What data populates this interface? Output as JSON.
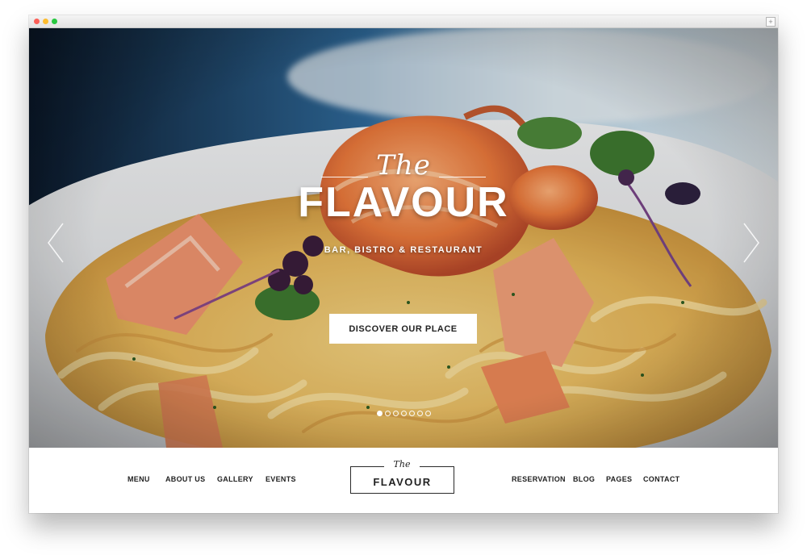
{
  "hero": {
    "logo_the": "The",
    "logo_main": "FLAVOUR",
    "tagline": "BAR, BISTRO & RESTAURANT",
    "cta_label": "DISCOVER OUR PLACE",
    "slide_count": 7,
    "active_slide": 1
  },
  "nav": {
    "left": [
      "MENU",
      "ABOUT US",
      "GALLERY",
      "EVENTS"
    ],
    "right": [
      "RESERVATION",
      "BLOG",
      "PAGES",
      "CONTACT"
    ],
    "logo_the": "The",
    "logo_main": "FLAVOUR"
  },
  "icons": {
    "prev": "chevron-left-icon",
    "next": "chevron-right-icon",
    "new_tab": "plus-icon"
  },
  "colors": {
    "nav_text": "#222222",
    "cta_bg": "#ffffff",
    "hero_text": "#ffffff"
  }
}
